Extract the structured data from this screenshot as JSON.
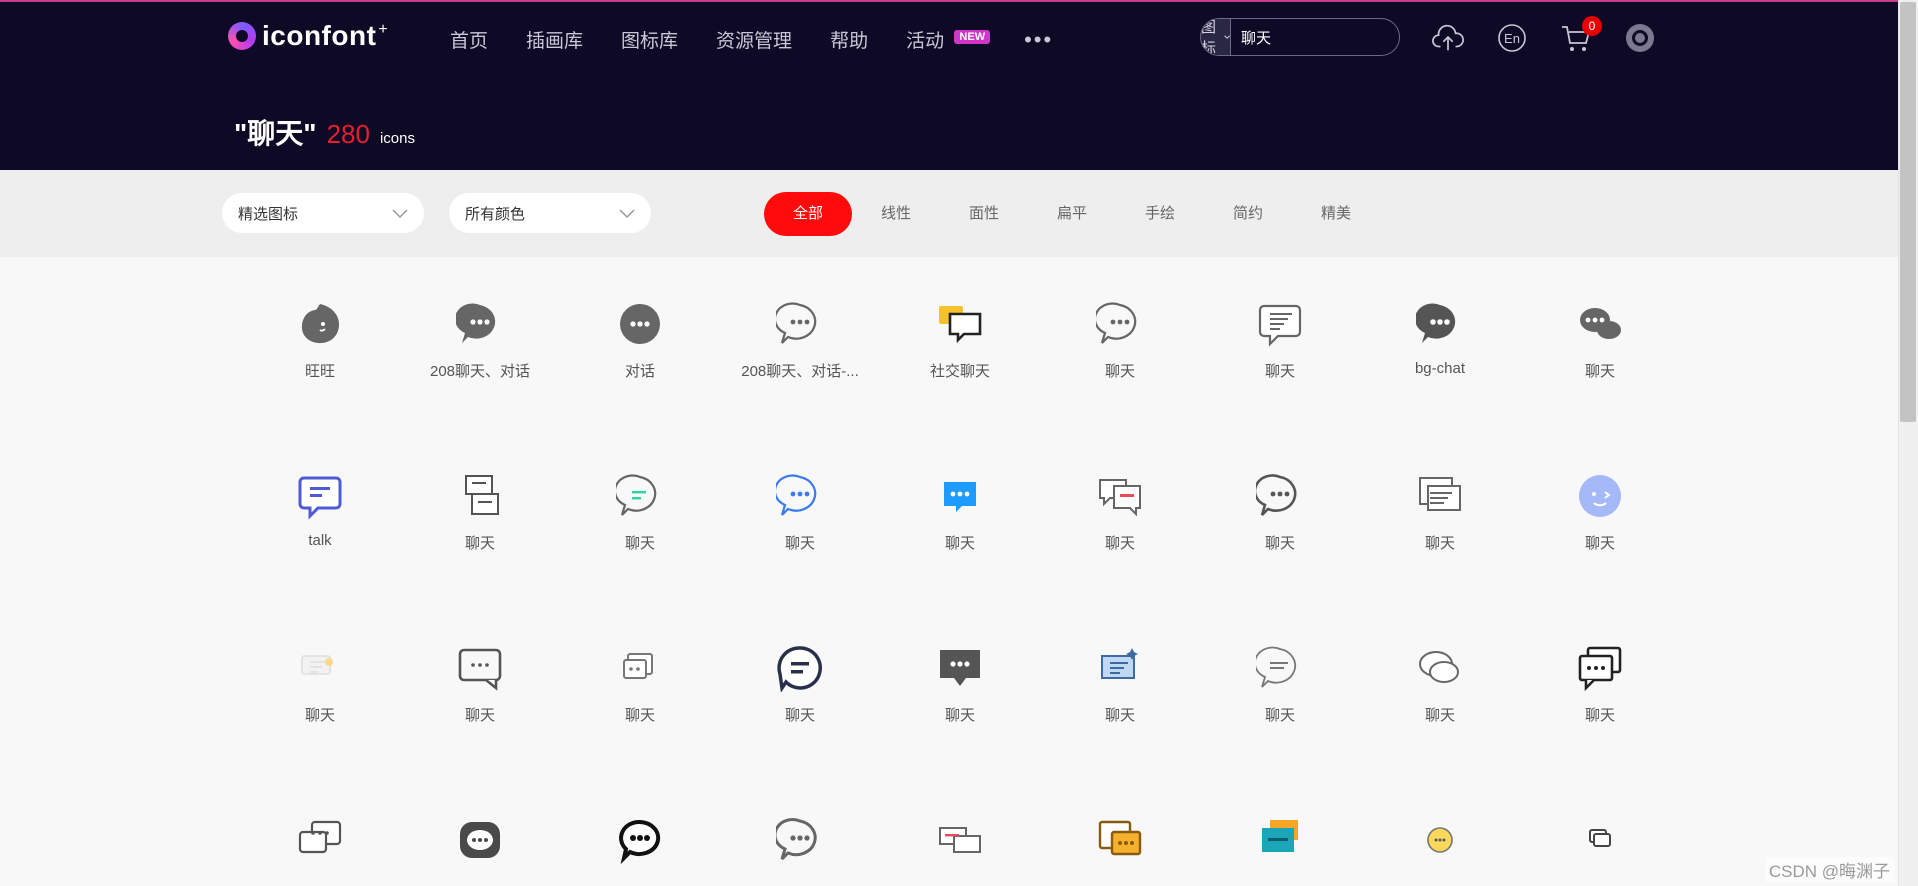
{
  "brand": {
    "name": "iconfont",
    "plus": "+"
  },
  "nav": {
    "items": [
      "首页",
      "插画库",
      "图标库",
      "资源管理",
      "帮助",
      "活动"
    ],
    "new_badge": "NEW",
    "more": "•••"
  },
  "search": {
    "type": "图标",
    "value": "聊天"
  },
  "cart": {
    "count": "0"
  },
  "result": {
    "query": "\"聊天\"",
    "count": "280",
    "unit": "icons"
  },
  "filters": {
    "selects": [
      "精选图标",
      "所有颜色"
    ],
    "tabs": [
      "全部",
      "线性",
      "面性",
      "扁平",
      "手绘",
      "简约",
      "精美"
    ],
    "active_tab": "全部"
  },
  "icons": [
    [
      {
        "label": "旺旺",
        "icon": "wangwang-icon"
      },
      {
        "label": "208聊天、对话",
        "icon": "chat-bubble-filled-icon"
      },
      {
        "label": "对话",
        "icon": "chat-round-filled-icon"
      },
      {
        "label": "208聊天、对话-...",
        "icon": "chat-bubble-outline-icon"
      },
      {
        "label": "社交聊天",
        "icon": "social-chat-icon"
      },
      {
        "label": "聊天",
        "icon": "chat-circle-outline-icon"
      },
      {
        "label": "聊天",
        "icon": "chat-lines-icon"
      },
      {
        "label": "bg-chat",
        "icon": "bg-chat-icon"
      },
      {
        "label": "聊天",
        "icon": "chat-double-icon"
      }
    ],
    [
      {
        "label": "talk",
        "icon": "talk-icon"
      },
      {
        "label": "聊天",
        "icon": "chat-stacked-icon"
      },
      {
        "label": "聊天",
        "icon": "chat-green-lines-icon"
      },
      {
        "label": "聊天",
        "icon": "chat-blue-outline-icon"
      },
      {
        "label": "聊天",
        "icon": "chat-blue-filled-icon"
      },
      {
        "label": "聊天",
        "icon": "chat-red-accent-icon"
      },
      {
        "label": "聊天",
        "icon": "chat-dots-outline-icon"
      },
      {
        "label": "聊天",
        "icon": "chat-docs-icon"
      },
      {
        "label": "聊天",
        "icon": "chat-face-icon"
      }
    ],
    [
      {
        "label": "聊天",
        "icon": "chat-faded-icon"
      },
      {
        "label": "聊天",
        "icon": "chat-rect-outline-icon"
      },
      {
        "label": "聊天",
        "icon": "chat-small-stack-icon"
      },
      {
        "label": "聊天",
        "icon": "chat-bold-lines-icon"
      },
      {
        "label": "聊天",
        "icon": "chat-dark-filled-icon"
      },
      {
        "label": "聊天",
        "icon": "chat-blue-sparkle-icon"
      },
      {
        "label": "聊天",
        "icon": "chat-thin-lines-icon"
      },
      {
        "label": "聊天",
        "icon": "chat-ovals-icon"
      },
      {
        "label": "聊天",
        "icon": "chat-black-double-icon"
      }
    ],
    [
      {
        "label": "",
        "icon": "chat-outline-pair-icon"
      },
      {
        "label": "",
        "icon": "chat-grey-filled-icon"
      },
      {
        "label": "",
        "icon": "chat-black-bold-icon"
      },
      {
        "label": "",
        "icon": "chat-grey-outline-icon"
      },
      {
        "label": "",
        "icon": "chat-red-pair-icon"
      },
      {
        "label": "",
        "icon": "chat-gold-icon"
      },
      {
        "label": "",
        "icon": "chat-teal-orange-icon"
      },
      {
        "label": "",
        "icon": "chat-yellow-face-icon"
      },
      {
        "label": "",
        "icon": "chat-tiny-icon"
      }
    ]
  ],
  "colors": {
    "header_bg": "#0e0a26",
    "accent": "#ff0b0b",
    "count": "#e61e2d"
  },
  "watermark": "CSDN @晦渊子"
}
